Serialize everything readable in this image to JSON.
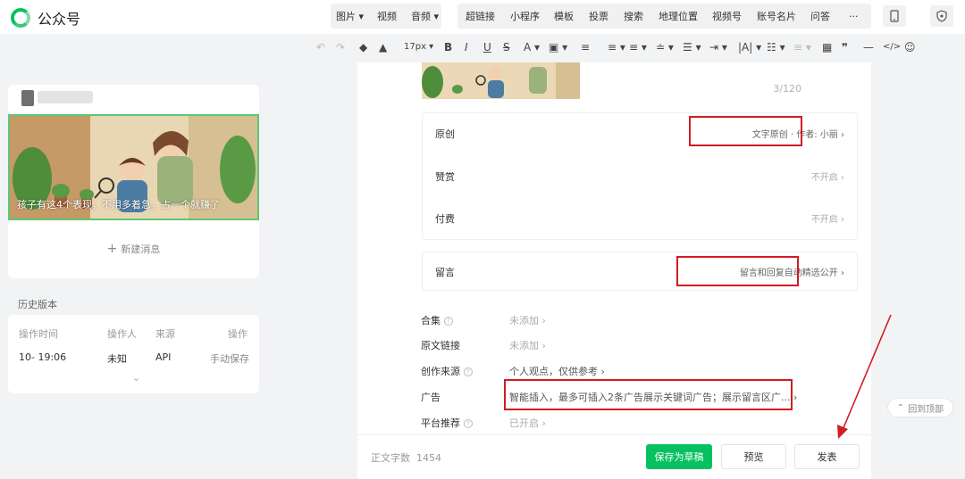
{
  "app": {
    "title": "公众号"
  },
  "topnav": {
    "insert_items": [
      "图片",
      "视频",
      "音频"
    ],
    "tools": [
      "超链接",
      "小程序",
      "模板",
      "投票",
      "搜索",
      "地理位置",
      "视频号",
      "账号名片",
      "问答"
    ],
    "more_label": "···"
  },
  "toolbar": {
    "font_size": "17px",
    "icons": [
      "undo-icon",
      "redo-icon",
      "format-brush-icon",
      "clear-format-icon",
      "bold-icon",
      "italic-icon",
      "underline-icon",
      "strikethrough-icon",
      "font-color-icon",
      "background-color-icon",
      "align-left-icon",
      "align-center-icon",
      "align-justify-icon",
      "align-right-icon",
      "line-height-icon",
      "indent-icon",
      "letter-spacing-icon",
      "list-icon",
      "more-format-icon",
      "table-icon",
      "quote-icon",
      "divider-icon",
      "code-icon",
      "emoji-icon"
    ]
  },
  "left_panel": {
    "article_caption": "孩子有这4个表现，不用多着急，占一个就赚了",
    "new_message": "新建消息",
    "history_title": "历史版本",
    "history_headers": [
      "操作时间",
      "操作人",
      "来源",
      "操作"
    ],
    "history_row": [
      "10-  19:06",
      "未知",
      "API",
      "手动保存"
    ]
  },
  "main": {
    "counter": "3/120",
    "settings": [
      {
        "label": "原创",
        "value": "文字原创 · 作者: 小丽"
      },
      {
        "label": "赞赏",
        "value": "不开启"
      },
      {
        "label": "付费",
        "value": "不开启"
      }
    ],
    "comment": {
      "label": "留言",
      "value": "留言和回复自动精选公开"
    },
    "options": [
      {
        "label": "合集",
        "value": "未添加"
      },
      {
        "label": "原文链接",
        "value": "未添加"
      },
      {
        "label": "创作来源",
        "value": "个人观点，仅供参考"
      },
      {
        "label": "广告",
        "value": "智能插入，最多可插入2条广告展示关键词广告；展示留言区广..."
      },
      {
        "label": "平台推荐",
        "value": "已开启"
      }
    ],
    "wordcount_label": "正文字数",
    "wordcount_value": "1454",
    "save_draft": "保存为草稿",
    "preview": "预览",
    "publish": "发表"
  },
  "back_to_top": "回到顶部",
  "colors": {
    "accent": "#07c160",
    "highlight": "#d11b25"
  }
}
